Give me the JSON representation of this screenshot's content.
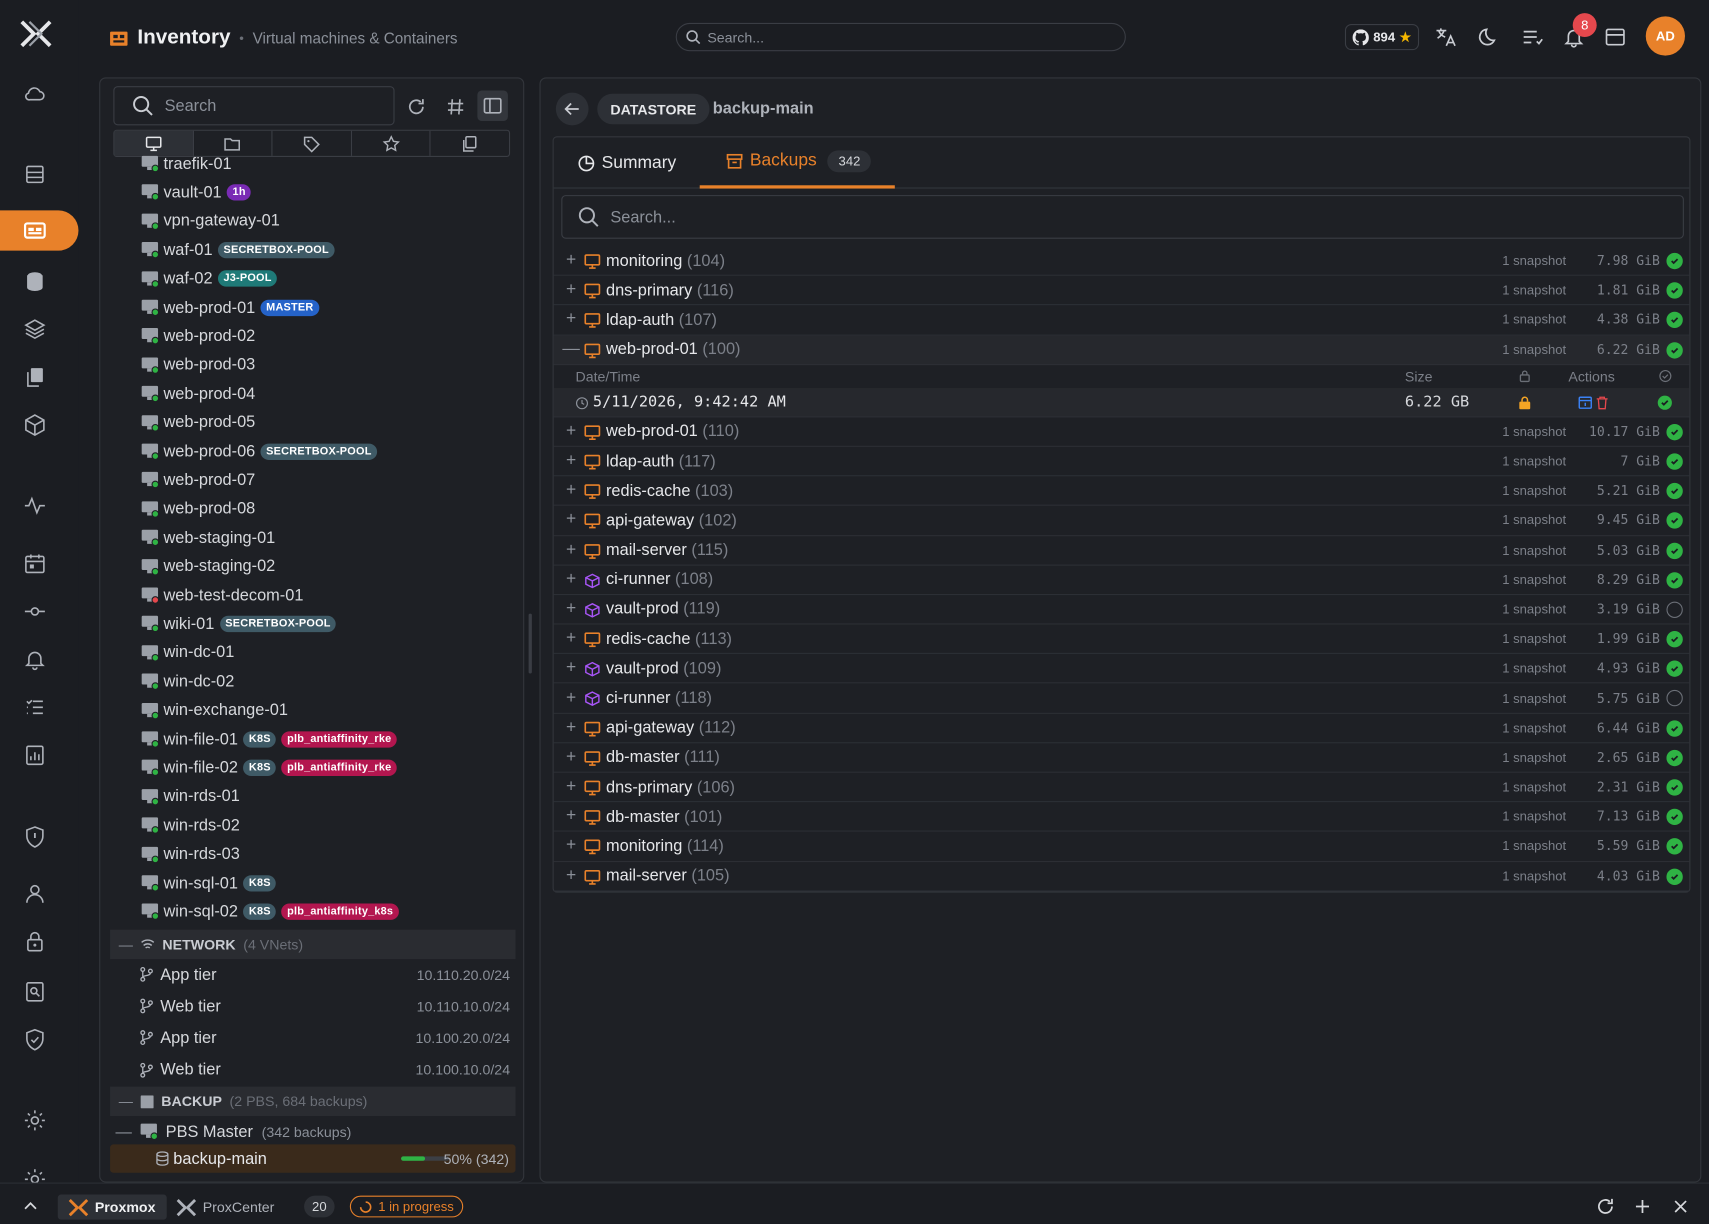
{
  "brand": {
    "accent": "#e8812a",
    "ok": "#2fb344",
    "danger": "#e5484d"
  },
  "header": {
    "title": "Inventory",
    "subtitle": "Virtual machines & Containers",
    "search_placeholder": "Search...",
    "github_stars": "894",
    "notifications": "8",
    "avatar": "AD"
  },
  "sidebar": {
    "icons": [
      "cloud-icon",
      "server-icon",
      "inventory-icon",
      "database-icon",
      "layers-icon",
      "copy-icon",
      "cube-icon",
      "activity-icon",
      "calendar-icon",
      "commit-icon",
      "bell-icon",
      "list-icon",
      "report-icon",
      "shield-icon",
      "user-icon",
      "lock-icon",
      "search-doc-icon",
      "shield-check-icon",
      "gear-icon",
      "gear-icon"
    ],
    "active": "inventory-icon"
  },
  "tree": {
    "search_placeholder": "Search",
    "vms": [
      {
        "name": "traefik-01",
        "status": "running",
        "tags": []
      },
      {
        "name": "vault-01",
        "status": "running",
        "tags": [
          {
            "text": "1h",
            "color": "#7a2bb5"
          }
        ]
      },
      {
        "name": "vpn-gateway-01",
        "status": "running",
        "tags": []
      },
      {
        "name": "waf-01",
        "status": "running",
        "tags": [
          {
            "text": "SECRETBOX-POOL",
            "color": "#3f5a66"
          }
        ]
      },
      {
        "name": "waf-02",
        "status": "running",
        "tags": [
          {
            "text": "J3-POOL",
            "color": "#1f7a78"
          }
        ]
      },
      {
        "name": "web-prod-01",
        "status": "running",
        "tags": [
          {
            "text": "MASTER",
            "color": "#2563c9"
          }
        ]
      },
      {
        "name": "web-prod-02",
        "status": "running",
        "tags": []
      },
      {
        "name": "web-prod-03",
        "status": "running",
        "tags": []
      },
      {
        "name": "web-prod-04",
        "status": "running",
        "tags": []
      },
      {
        "name": "web-prod-05",
        "status": "running",
        "tags": []
      },
      {
        "name": "web-prod-06",
        "status": "running",
        "tags": [
          {
            "text": "SECRETBOX-POOL",
            "color": "#3f5a66"
          }
        ]
      },
      {
        "name": "web-prod-07",
        "status": "running",
        "tags": []
      },
      {
        "name": "web-prod-08",
        "status": "running",
        "tags": []
      },
      {
        "name": "web-staging-01",
        "status": "running",
        "tags": []
      },
      {
        "name": "web-staging-02",
        "status": "running",
        "tags": []
      },
      {
        "name": "web-test-decom-01",
        "status": "stopped",
        "tags": []
      },
      {
        "name": "wiki-01",
        "status": "running",
        "tags": [
          {
            "text": "SECRETBOX-POOL",
            "color": "#3f5a66"
          }
        ]
      },
      {
        "name": "win-dc-01",
        "status": "running",
        "tags": []
      },
      {
        "name": "win-dc-02",
        "status": "running",
        "tags": []
      },
      {
        "name": "win-exchange-01",
        "status": "running",
        "tags": []
      },
      {
        "name": "win-file-01",
        "status": "running",
        "tags": [
          {
            "text": "K8S",
            "color": "#3f5a66"
          },
          {
            "text": "plb_antiaffinity_rke",
            "color": "#b3164f"
          }
        ]
      },
      {
        "name": "win-file-02",
        "status": "running",
        "tags": [
          {
            "text": "K8S",
            "color": "#3f5a66"
          },
          {
            "text": "plb_antiaffinity_rke",
            "color": "#b3164f"
          }
        ]
      },
      {
        "name": "win-rds-01",
        "status": "running",
        "tags": []
      },
      {
        "name": "win-rds-02",
        "status": "running",
        "tags": []
      },
      {
        "name": "win-rds-03",
        "status": "running",
        "tags": []
      },
      {
        "name": "win-sql-01",
        "status": "running",
        "tags": [
          {
            "text": "K8S",
            "color": "#3f5a66"
          }
        ]
      },
      {
        "name": "win-sql-02",
        "status": "running",
        "tags": [
          {
            "text": "K8S",
            "color": "#3f5a66"
          },
          {
            "text": "plb_antiaffinity_k8s",
            "color": "#b3164f"
          }
        ]
      }
    ],
    "network": {
      "label": "NETWORK",
      "count": "(4 VNets)",
      "items": [
        {
          "name": "App tier",
          "cidr": "10.110.20.0/24"
        },
        {
          "name": "Web tier",
          "cidr": "10.110.10.0/24"
        },
        {
          "name": "App tier",
          "cidr": "10.100.20.0/24"
        },
        {
          "name": "Web tier",
          "cidr": "10.100.10.0/24"
        }
      ]
    },
    "backup": {
      "label": "BACKUP",
      "count": "(2 PBS, 684 backups)",
      "pbs_name": "PBS Master",
      "pbs_count": "(342 backups)",
      "datastore": "backup-main",
      "usage": 0.5,
      "usage_text": "50% (342)"
    }
  },
  "detail": {
    "kind": "DATASTORE",
    "name": "backup-main",
    "tab_summary": "Summary",
    "tab_backups": "Backups",
    "backup_count": "342",
    "search_placeholder": "Search...",
    "col_datetime": "Date/Time",
    "col_size": "Size",
    "col_actions": "Actions",
    "groups": [
      {
        "name": "monitoring",
        "id": "(104)",
        "kind": "vm",
        "snapshots": "1 snapshot",
        "size": "7.98 GiB",
        "status": "ok"
      },
      {
        "name": "dns-primary",
        "id": "(116)",
        "kind": "vm",
        "snapshots": "1 snapshot",
        "size": "1.81 GiB",
        "status": "ok"
      },
      {
        "name": "ldap-auth",
        "id": "(107)",
        "kind": "vm",
        "snapshots": "1 snapshot",
        "size": "4.38 GiB",
        "status": "ok"
      },
      {
        "name": "web-prod-01",
        "id": "(100)",
        "kind": "vm",
        "snapshots": "1 snapshot",
        "size": "6.22 GiB",
        "status": "ok",
        "expanded": true,
        "entries": [
          {
            "datetime": "5/11/2026, 9:42:42 AM",
            "size": "6.22 GB"
          }
        ]
      },
      {
        "name": "web-prod-01",
        "id": "(110)",
        "kind": "vm",
        "snapshots": "1 snapshot",
        "size": "10.17 GiB",
        "status": "ok"
      },
      {
        "name": "ldap-auth",
        "id": "(117)",
        "kind": "vm",
        "snapshots": "1 snapshot",
        "size": "7 GiB",
        "status": "ok"
      },
      {
        "name": "redis-cache",
        "id": "(103)",
        "kind": "vm",
        "snapshots": "1 snapshot",
        "size": "5.21 GiB",
        "status": "ok"
      },
      {
        "name": "api-gateway",
        "id": "(102)",
        "kind": "vm",
        "snapshots": "1 snapshot",
        "size": "9.45 GiB",
        "status": "ok"
      },
      {
        "name": "mail-server",
        "id": "(115)",
        "kind": "vm",
        "snapshots": "1 snapshot",
        "size": "5.03 GiB",
        "status": "ok"
      },
      {
        "name": "ci-runner",
        "id": "(108)",
        "kind": "ct",
        "snapshots": "1 snapshot",
        "size": "8.29 GiB",
        "status": "ok"
      },
      {
        "name": "vault-prod",
        "id": "(119)",
        "kind": "ct",
        "snapshots": "1 snapshot",
        "size": "3.19 GiB",
        "status": "pending"
      },
      {
        "name": "redis-cache",
        "id": "(113)",
        "kind": "vm",
        "snapshots": "1 snapshot",
        "size": "1.99 GiB",
        "status": "ok"
      },
      {
        "name": "vault-prod",
        "id": "(109)",
        "kind": "ct",
        "snapshots": "1 snapshot",
        "size": "4.93 GiB",
        "status": "ok"
      },
      {
        "name": "ci-runner",
        "id": "(118)",
        "kind": "ct",
        "snapshots": "1 snapshot",
        "size": "5.75 GiB",
        "status": "pending"
      },
      {
        "name": "api-gateway",
        "id": "(112)",
        "kind": "vm",
        "snapshots": "1 snapshot",
        "size": "6.44 GiB",
        "status": "ok"
      },
      {
        "name": "db-master",
        "id": "(111)",
        "kind": "vm",
        "snapshots": "1 snapshot",
        "size": "2.65 GiB",
        "status": "ok"
      },
      {
        "name": "dns-primary",
        "id": "(106)",
        "kind": "vm",
        "snapshots": "1 snapshot",
        "size": "2.31 GiB",
        "status": "ok"
      },
      {
        "name": "db-master",
        "id": "(101)",
        "kind": "vm",
        "snapshots": "1 snapshot",
        "size": "7.13 GiB",
        "status": "ok"
      },
      {
        "name": "monitoring",
        "id": "(114)",
        "kind": "vm",
        "snapshots": "1 snapshot",
        "size": "5.59 GiB",
        "status": "ok"
      },
      {
        "name": "mail-server",
        "id": "(105)",
        "kind": "vm",
        "snapshots": "1 snapshot",
        "size": "4.03 GiB",
        "status": "ok"
      }
    ]
  },
  "statusbar": {
    "tab1": "Proxmox",
    "tab2": "ProxCenter",
    "count": "20",
    "progress": "1 in progress"
  }
}
